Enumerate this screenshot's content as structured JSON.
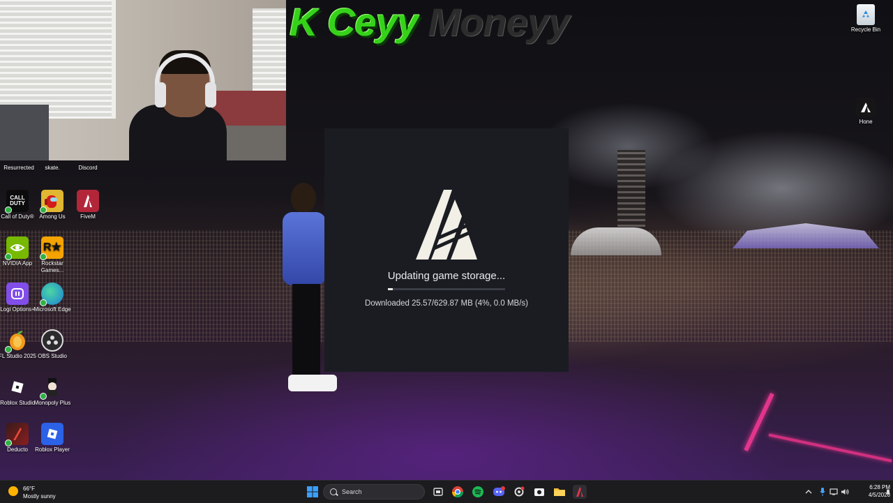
{
  "banner": {
    "text_main": "K Ceyy",
    "text_tail": "Moneyy"
  },
  "desktop": {
    "top_right_icons": [
      {
        "label": "Recycle Bin"
      },
      {
        "label": "Hone"
      }
    ],
    "icons": [
      {
        "label": "Resurrected"
      },
      {
        "label": "skate."
      },
      {
        "label": "Discord"
      },
      {
        "label": "Call of Duty®"
      },
      {
        "label": "Among Us"
      },
      {
        "label": "FiveM"
      },
      {
        "label": "NVIDIA App"
      },
      {
        "label": "Rockstar Games..."
      },
      {
        "label": "Logi Options+"
      },
      {
        "label": "Microsoft Edge"
      },
      {
        "label": "FL Studio 2025"
      },
      {
        "label": "OBS Studio"
      },
      {
        "label": "Roblox Studio"
      },
      {
        "label": "Monopoly Plus"
      },
      {
        "label": "Deducto"
      },
      {
        "label": "Roblox Player"
      }
    ]
  },
  "loader": {
    "status": "Updating game storage...",
    "progress_percent": 4,
    "detail": "Downloaded 25.57/629.87 MB (4%, 0.0 MB/s)"
  },
  "taskbar": {
    "weather_temp": "66°F",
    "weather_desc": "Mostly sunny",
    "search_label": "Search",
    "clock_time": "6:28 PM",
    "clock_date": "4/5/2026"
  },
  "colors": {
    "banner_green": "#36d21a",
    "loader_bg": "#1a1c22",
    "taskbar_bg": "#1c1c1f",
    "fivem_red": "#b3263a"
  }
}
